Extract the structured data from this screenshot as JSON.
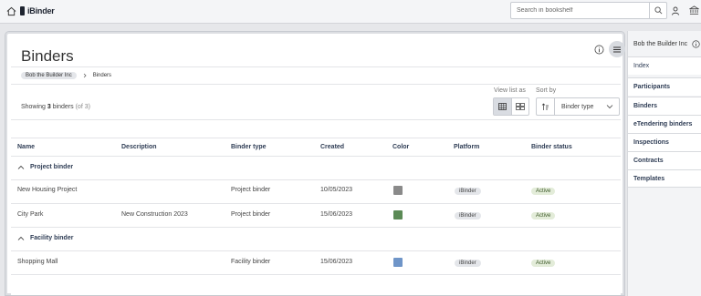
{
  "topbar": {
    "logo_text": "iBinder",
    "search_placeholder": "Search in bookshelf"
  },
  "page": {
    "title": "Binders",
    "breadcrumb": {
      "org": "Bob the Builder Inc",
      "current": "Binders"
    },
    "showing_prefix": "Showing",
    "showing_count": "3",
    "showing_mid": "binders",
    "showing_of": "(of 3)",
    "view_label": "View list as",
    "sort_label": "Sort by",
    "sort_value": "Binder type"
  },
  "table": {
    "headers": [
      "Name",
      "Description",
      "Binder type",
      "Created",
      "Color",
      "Platform",
      "Binder status"
    ],
    "groups": [
      {
        "label": "Project binder",
        "rows": [
          {
            "name": "New Housing Project",
            "description": "",
            "type": "Project binder",
            "created": "10/05/2023",
            "color": "#8a8a8a",
            "platform": "iBinder",
            "status": "Active"
          },
          {
            "name": "City Park",
            "description": "New Construction 2023",
            "type": "Project binder",
            "created": "15/06/2023",
            "color": "#5b8a56",
            "platform": "iBinder",
            "status": "Active"
          }
        ]
      },
      {
        "label": "Facility binder",
        "rows": [
          {
            "name": "Shopping Mall",
            "description": "",
            "type": "Facility binder",
            "created": "15/06/2023",
            "color": "#6f95c8",
            "platform": "iBinder",
            "status": "Active"
          }
        ]
      }
    ]
  },
  "right_panel": {
    "org": "Bob the Builder Inc",
    "items": [
      {
        "label": "Index",
        "bold": false
      },
      {
        "label": "Participants",
        "bold": true
      },
      {
        "label": "Binders",
        "bold": true
      },
      {
        "label": "eTendering binders",
        "bold": true
      },
      {
        "label": "Inspections",
        "bold": true
      },
      {
        "label": "Contracts",
        "bold": true
      },
      {
        "label": "Templates",
        "bold": true
      }
    ]
  },
  "colors": {
    "accent": "#2f3d55",
    "active_status_bg": "#e3ecd9"
  }
}
